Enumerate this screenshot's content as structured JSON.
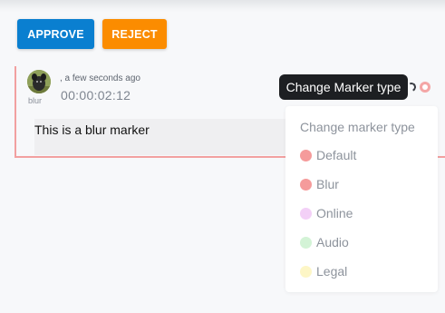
{
  "actions": {
    "approve_label": "APPROVE",
    "approve_color": "#0a7fd0",
    "reject_label": "REJECT",
    "reject_color": "#fb8c00"
  },
  "comment": {
    "author": "blur",
    "time_ago": ", a few seconds ago",
    "timecode": "00:00:02:12",
    "text": "This is a blur marker",
    "marker_color": "#f4a6a6"
  },
  "tooltip": {
    "text": "Change Marker type"
  },
  "marker_menu": {
    "title": "Change marker type",
    "options": [
      {
        "label": "Default",
        "color": "#f59b9b"
      },
      {
        "label": "Blur",
        "color": "#f59b9b"
      },
      {
        "label": "Online",
        "color": "#f3d0f7"
      },
      {
        "label": "Audio",
        "color": "#d3f3d6"
      },
      {
        "label": "Legal",
        "color": "#fdf6c6"
      }
    ]
  }
}
